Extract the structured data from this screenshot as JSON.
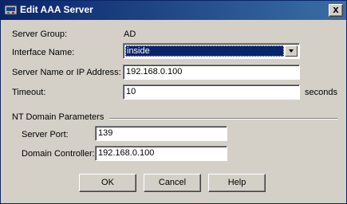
{
  "window": {
    "title": "Edit AAA Server",
    "close_label": "x"
  },
  "form": {
    "server_group_label": "Server Group:",
    "server_group_value": "AD",
    "interface_label": "Interface Name:",
    "interface_value": "inside",
    "server_name_label": "Server Name or IP Address:",
    "server_name_value": "192.168.0.100",
    "timeout_label": "Timeout:",
    "timeout_value": "10",
    "timeout_unit": "seconds"
  },
  "nt_domain": {
    "group_title": "NT Domain Parameters",
    "server_port_label": "Server Port:",
    "server_port_value": "139",
    "domain_controller_label": "Domain Controller:",
    "domain_controller_value": "192.168.0.100"
  },
  "buttons": {
    "ok": "OK",
    "cancel": "Cancel",
    "help": "Help"
  }
}
